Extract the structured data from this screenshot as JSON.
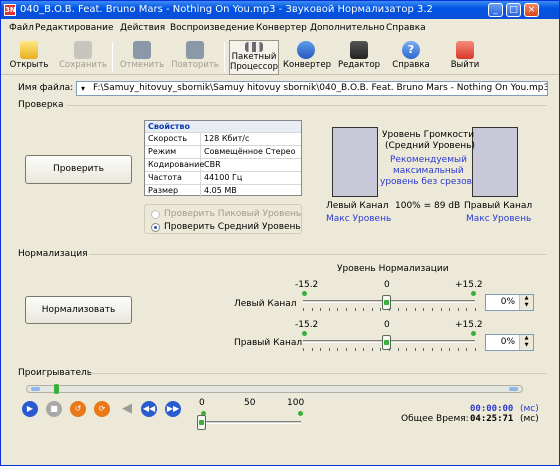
{
  "window": {
    "title": "040_B.O.B. Feat. Bruno Mars - Nothing On You.mp3 - Звуковой Нормализатор 3.2",
    "app_icon": "3N"
  },
  "menu": [
    "Файл",
    "Редактирование",
    "Действия",
    "Воспроизведение",
    "Конвертер",
    "Дополнительно",
    "Справка"
  ],
  "toolbar": {
    "open": "Открыть",
    "save": "Сохранить",
    "undo": "Отменить",
    "redo": "Повторить",
    "batch": "Пакетный",
    "batch2": "Процессор",
    "converter": "Конвертер",
    "editor": "Редактор",
    "help": "Справка",
    "exit": "Выйти"
  },
  "file": {
    "label": "Имя файла:",
    "path": "F:\\Samuy_hitovuy_sbornik\\Samuy hitovuy sbornik\\040_B.O.B. Feat. Bruno Mars - Nothing On You.mp3"
  },
  "check": {
    "section": "Проверка",
    "button": "Проверить",
    "props_header": "Свойство",
    "props": [
      {
        "key": "Скорость",
        "value": "128 Кбит/с"
      },
      {
        "key": "Режим",
        "value": "Совмещённое Стерео"
      },
      {
        "key": "Кодирование",
        "value": "CBR"
      },
      {
        "key": "Частота",
        "value": "44100 Гц"
      },
      {
        "key": "Размер",
        "value": "4.05 MB"
      }
    ],
    "radio_peak": "Проверить Пиковый Уровень",
    "radio_avg": "Проверить Средний Уровень",
    "loudness_title1": "Уровень Громкости",
    "loudness_title2": "(Средний Уровень)",
    "recommended1": "Рекомендуемый",
    "recommended2": "максимальный",
    "recommended3": "уровень без срезов",
    "left_channel": "Левый Канал",
    "right_channel": "Правый Канал",
    "max_level": "Макс Уровень",
    "center_value": "100% = 89 dB"
  },
  "normalize": {
    "section": "Нормализация",
    "button": "Нормализовать",
    "level_title": "Уровень Нормализации",
    "min": "-15.2",
    "zero": "0",
    "max": "+15.2",
    "left_label": "Левый Канал",
    "right_label": "Правый Канал",
    "left_value": "0%",
    "right_value": "0%"
  },
  "player": {
    "section": "Проигрыватель",
    "vol_min": "0",
    "vol_mid": "50",
    "vol_max": "100",
    "current_time": "00:00:00",
    "time_unit": "(мс)",
    "total_label": "Общее Время:",
    "total_time": "04:25:71",
    "total_unit": "(мс)"
  },
  "colors": {
    "accent": "#0054e3",
    "link": "#2a3ad0",
    "slider": "#3ab03a"
  }
}
